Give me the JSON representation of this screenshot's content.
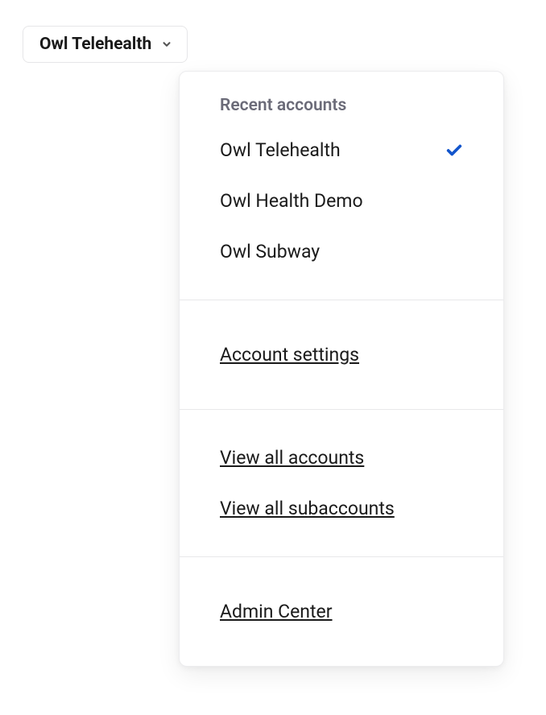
{
  "trigger": {
    "label": "Owl Telehealth"
  },
  "dropdown": {
    "recent_title": "Recent accounts",
    "accounts": [
      {
        "name": "Owl Telehealth",
        "selected": true
      },
      {
        "name": "Owl Health Demo",
        "selected": false
      },
      {
        "name": "Owl Subway",
        "selected": false
      }
    ],
    "settings_link": "Account settings",
    "view_all_accounts": "View all accounts",
    "view_all_subaccounts": "View all subaccounts",
    "admin_center": "Admin Center"
  },
  "colors": {
    "check": "#1255cc",
    "muted": "#6b6b78",
    "text": "#1a1a1a",
    "border": "#e8e8ea"
  }
}
